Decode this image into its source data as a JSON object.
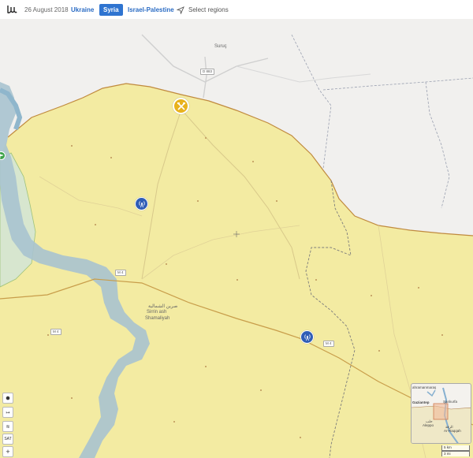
{
  "header": {
    "date": "26 August 2018",
    "tabs": [
      {
        "label": "Ukraine"
      },
      {
        "label": "Syria"
      },
      {
        "label": "Israel-Palestine"
      }
    ],
    "select_regions": "Select regions"
  },
  "map": {
    "labels": {
      "suruc": "Suruç",
      "sirrin_ar": "صرين الشمالية",
      "sirrin_en": "Sirrin ash",
      "sirrin_en2": "Shamaliyah"
    },
    "roads": {
      "d883": "D 883",
      "m4a": "M 4",
      "m4b": "M 4",
      "m4c": "M 4"
    },
    "colors": {
      "syria_territory": "#f3eba2",
      "turkey": "#f1f0ee",
      "green_zone": "#d8e8d0",
      "river": "#a9c3cf",
      "border": "#c08a3e",
      "frontline": "#8a8a8a"
    },
    "markers": [
      {
        "type": "wifi",
        "icon": "signal-tower-icon"
      },
      {
        "type": "wifi",
        "icon": "signal-tower-icon"
      },
      {
        "type": "crossed-hammers",
        "icon": "crossed-hammers-icon"
      },
      {
        "type": "green",
        "icon": "flag-icon"
      }
    ]
  },
  "controls": {
    "hex": "⬢",
    "measure": "↦",
    "layers": "≋",
    "sat": "SAT",
    "zoom_in": "+"
  },
  "minimap": {
    "labels": {
      "kahramanmaras": "ahramanmaraş",
      "gaziantep": "Gaziantep",
      "sanliurfa": "Şanlıurfa",
      "aleppo_ar": "حلب",
      "aleppo": "Aleppo",
      "raqqah_ar": "الرقة",
      "raqqah": "Ar-Raqqah"
    }
  },
  "scale": {
    "km": "5 km",
    "mi": "3 mi"
  }
}
